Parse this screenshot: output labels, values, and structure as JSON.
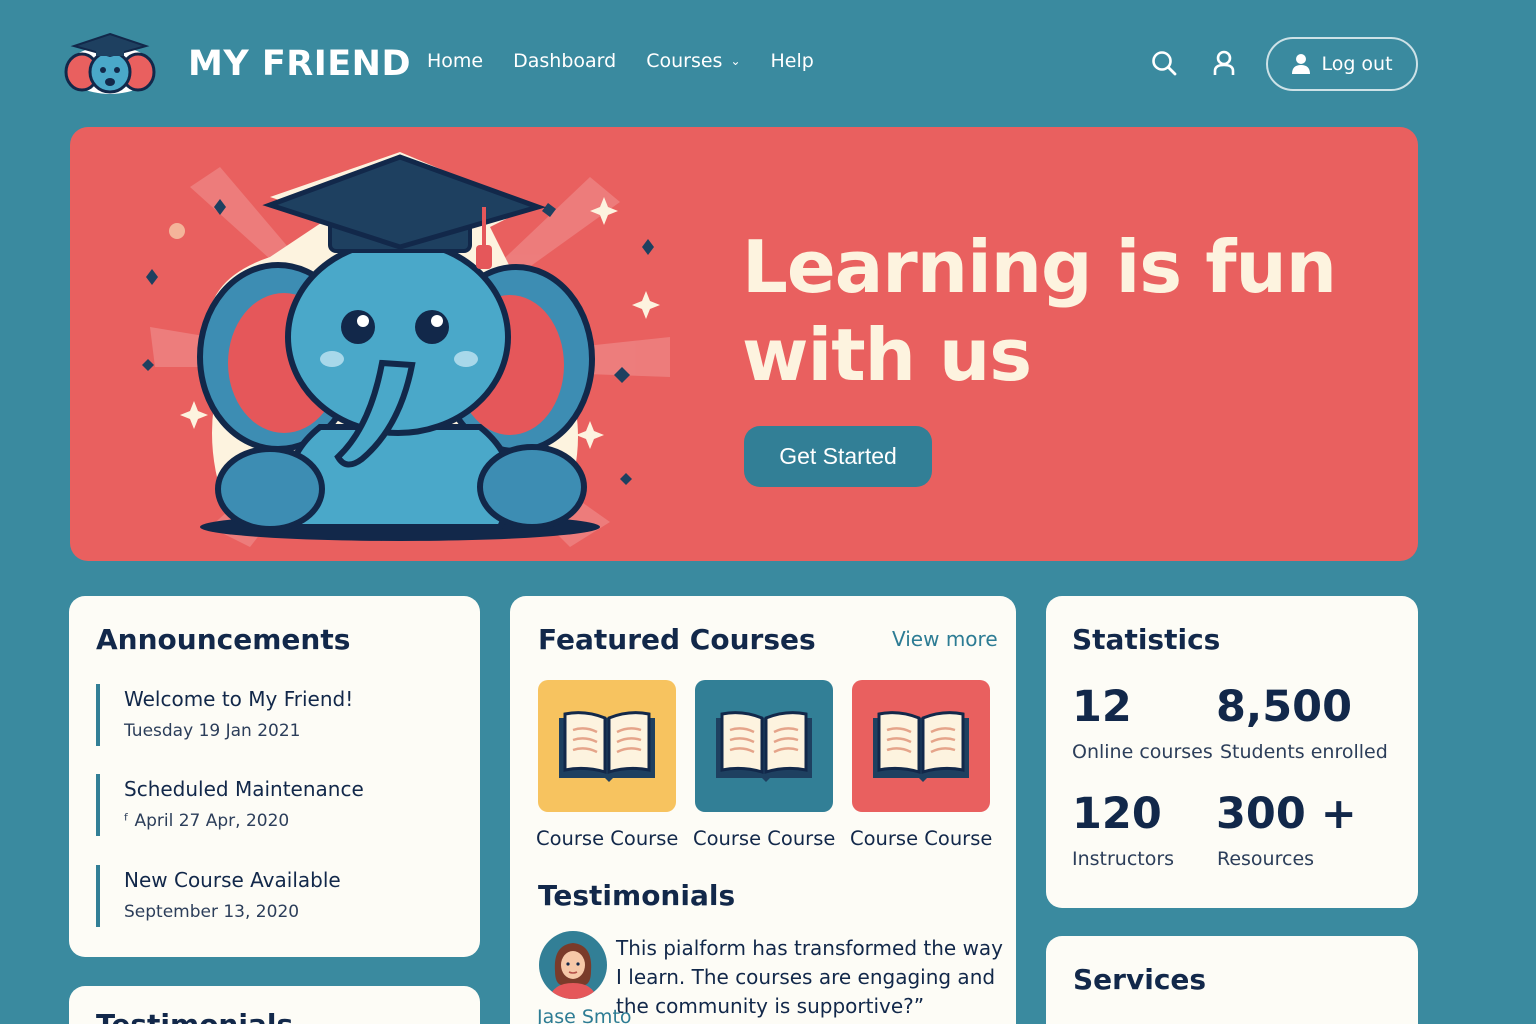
{
  "header": {
    "brand": "MY FRIEND",
    "nav": [
      {
        "label": "Home"
      },
      {
        "label": "Dashboard"
      },
      {
        "label": "Courses",
        "has_dropdown": true
      },
      {
        "label": "Help"
      }
    ],
    "icons": [
      "search-icon",
      "user-icon"
    ],
    "logout_label": "Log out"
  },
  "hero": {
    "title_line1": "Learning is fun",
    "title_line2": "with us",
    "cta_label": "Get Started"
  },
  "announcements": {
    "title": "Announcements",
    "items": [
      {
        "title": "Welcome to My Friend!",
        "date": "Tuesday  19 Jan 2021"
      },
      {
        "title": "Scheduled Maintenance",
        "date": "ᶠ April 27 Apr, 2020"
      },
      {
        "title": "New Course Available",
        "date": "September 13, 2020"
      }
    ]
  },
  "testimonials_card_left": {
    "title": "Testimonials"
  },
  "featured": {
    "title": "Featured Courses",
    "view_more": "View more",
    "courses": [
      {
        "label": "Course Course",
        "color": "#f7c35f"
      },
      {
        "label": "Course Course",
        "color": "#327f96"
      },
      {
        "label": "Course Course",
        "color": "#e9605f"
      }
    ]
  },
  "testimonials": {
    "title": "Testimonials",
    "quote": "This pialform has transformed the way I learn. The courses are engaging and the community is supportive?”",
    "name": "Jase Smto"
  },
  "statistics": {
    "title": "Statistics",
    "items": [
      {
        "value": "12",
        "label": "Online courses"
      },
      {
        "value": "8,500",
        "label": "Students enrolled"
      },
      {
        "value": "120",
        "label": "Instructors"
      },
      {
        "value": "300 +",
        "label": "Resources"
      }
    ]
  },
  "services": {
    "title": "Services"
  },
  "colors": {
    "background": "#3a8a9f",
    "hero": "#e9605f",
    "accent": "#327f96",
    "card": "#fdfcf6",
    "text": "#12284a"
  }
}
